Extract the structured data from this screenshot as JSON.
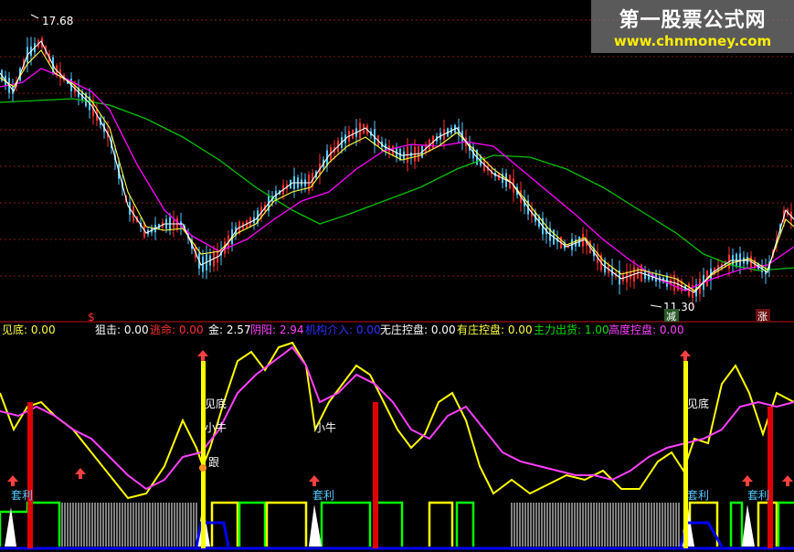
{
  "price_panel": {
    "high_label": "17.68",
    "low_label": "11.30",
    "marker_dollar": "$",
    "marker_jian": "减",
    "marker_zhang": "涨"
  },
  "indicator_bar": {
    "jiandi": "见底: 0.00",
    "juji": "狙击: 0.00",
    "taoming": "逃命: 0.00",
    "jin": "金: 2.57",
    "yinyang": "阴阳: 2.94",
    "jigou": "机构介入: 0.00",
    "wuzhuang": "无庄控盘: 0.00",
    "youzhuang": "有庄控盘: 0.00",
    "zhuli": "主力出货: 1.00",
    "gaodu": "高度控盘: 0.00"
  },
  "annotations": {
    "jiandi_1": "见底",
    "jiandi_2": "见底",
    "xiaoniu_1": "小牛",
    "xiaoniu_2": "小牛",
    "genjin": "跟",
    "taoli_1": "套利",
    "taoli_2": "套利",
    "taoli_3": "套利",
    "taoli_4": "套利"
  },
  "watermark": {
    "title": "第一股票公式网",
    "url": "www.chnmoney.com"
  },
  "colors": {
    "background": "#000000",
    "up": "#ff3030",
    "down": "#54c8ff",
    "ma_white": "#ffffff",
    "ma_yellow": "#ffff00",
    "ma_magenta": "#ff00ff",
    "ma_green": "#00c800",
    "grid": "#a01818",
    "signal_red": "#e00000",
    "bar_white": "#ffffff",
    "band_green": "#00ff00",
    "band_blue": "#0000ff"
  }
}
